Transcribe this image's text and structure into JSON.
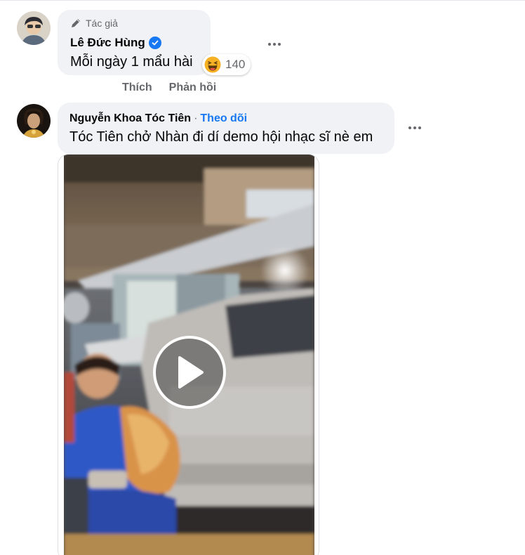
{
  "comments": [
    {
      "author_badge_icon": "pencil-icon",
      "author_badge": "Tác giả",
      "name": "Lê Đức Hùng",
      "verified": true,
      "text": "Mỗi ngày 1 mẩu hài",
      "reaction": {
        "icon": "haha-emoji-icon",
        "count": "140"
      },
      "actions": {
        "like": "Thích",
        "reply": "Phản hồi"
      }
    },
    {
      "name": "Nguyễn Khoa Tóc Tiên",
      "separator": "·",
      "follow": "Theo dõi",
      "text": "Tóc Tiên chở Nhàn đi dí demo hội nhạc sĩ nè em",
      "attachment": {
        "type": "video",
        "play_icon": "play-icon"
      }
    }
  ],
  "colors": {
    "bubble": "#f0f2f5",
    "link_blue": "#1877f2",
    "secondary_text": "#65676b"
  }
}
